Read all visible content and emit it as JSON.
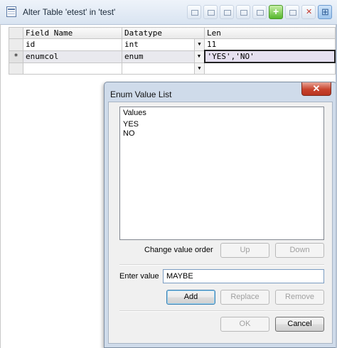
{
  "window": {
    "title": "Alter Table 'etest' in 'test'"
  },
  "toolbar": {
    "icons": [
      "add-row-icon",
      "delete-row-icon",
      "grid-icon",
      "grid-icon",
      "table-view-icon"
    ]
  },
  "grid": {
    "columns": [
      "Field Name",
      "Datatype",
      "Len"
    ],
    "rows": [
      {
        "marker": "",
        "field": "id",
        "datatype": "int",
        "len": "11"
      },
      {
        "marker": "*",
        "field": "enumcol",
        "datatype": "enum",
        "len": "'YES','NO'"
      },
      {
        "marker": "",
        "field": "",
        "datatype": "",
        "len": ""
      }
    ]
  },
  "dialog": {
    "title": "Enum Value List",
    "close_label": "✕",
    "values_label": "Values",
    "values": [
      "YES",
      "NO"
    ],
    "change_order_label": "Change value order",
    "up_label": "Up",
    "down_label": "Down",
    "enter_value_label": "Enter value",
    "enter_value": "MAYBE",
    "add_label": "Add",
    "replace_label": "Replace",
    "remove_label": "Remove",
    "ok_label": "OK",
    "cancel_label": "Cancel"
  }
}
